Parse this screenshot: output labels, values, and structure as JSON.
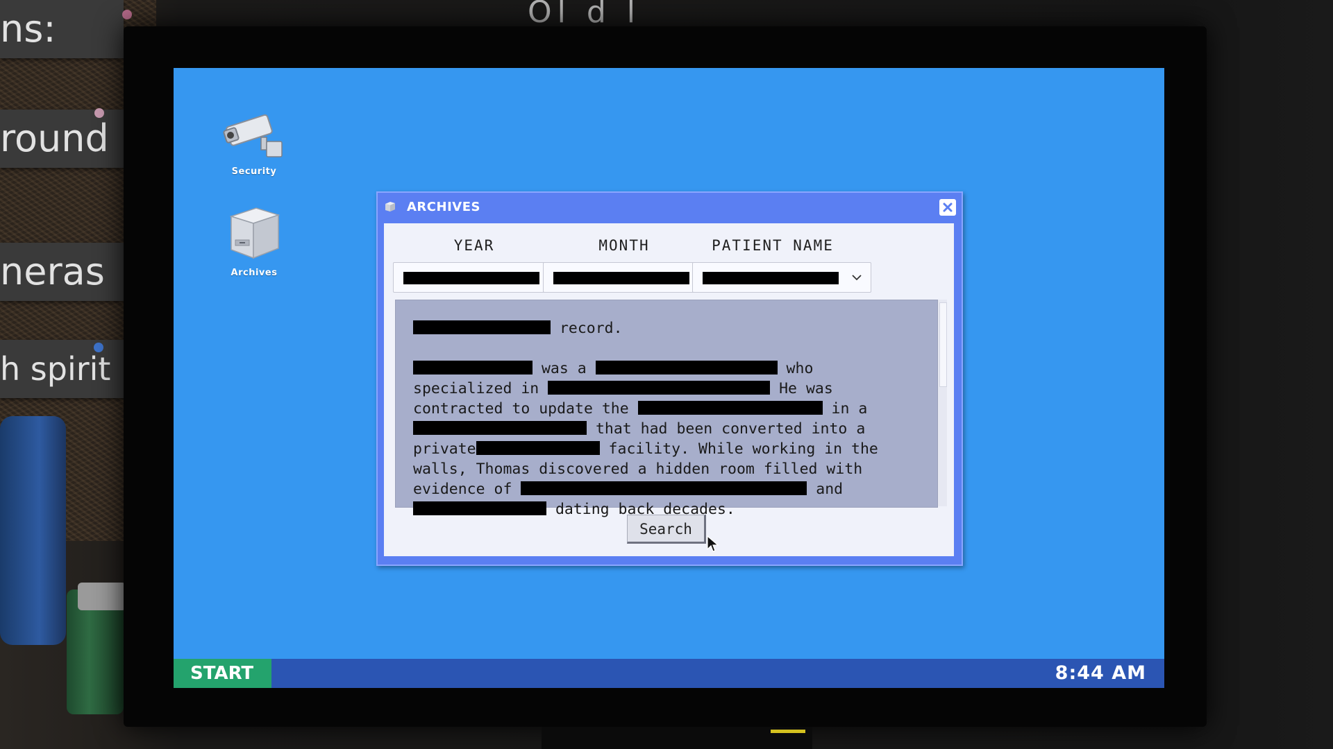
{
  "background": {
    "cards": [
      {
        "text": "ns:"
      },
      {
        "text": "round"
      },
      {
        "text": "neras"
      },
      {
        "text": "h spirit"
      }
    ],
    "top_bleed_text": "Ol    d  l  "
  },
  "desktop": {
    "icons": [
      {
        "label": "Security",
        "icon": "security-camera-icon"
      },
      {
        "label": "Archives",
        "icon": "file-cabinet-icon"
      }
    ]
  },
  "window": {
    "title": "ARCHIVES",
    "columns": [
      "YEAR",
      "MONTH",
      "PATIENT NAME"
    ],
    "record": {
      "line1": " record.",
      "p_was_a": " was a ",
      "p_who": " who",
      "p_specialized": "specialized in ",
      "p_he_was": " He was",
      "p_contracted": "contracted to update the ",
      "p_in_a": " in a",
      "p_that_had": " that had been converted into a",
      "p_private": "private",
      "p_facility": " facility. While working in the",
      "p_walls": "walls, Thomas discovered a hidden room filled with",
      "p_evidence": "evidence of ",
      "p_and": " and",
      "p_dating": " dating back decades."
    },
    "search_label": "Search"
  },
  "taskbar": {
    "start_label": "START",
    "clock": "8:44 AM"
  },
  "colors": {
    "desktop_bg": "#3697f0",
    "window_frame": "#5b7ff2",
    "taskbar": "#2b55b3",
    "start_button": "#24a36d"
  }
}
